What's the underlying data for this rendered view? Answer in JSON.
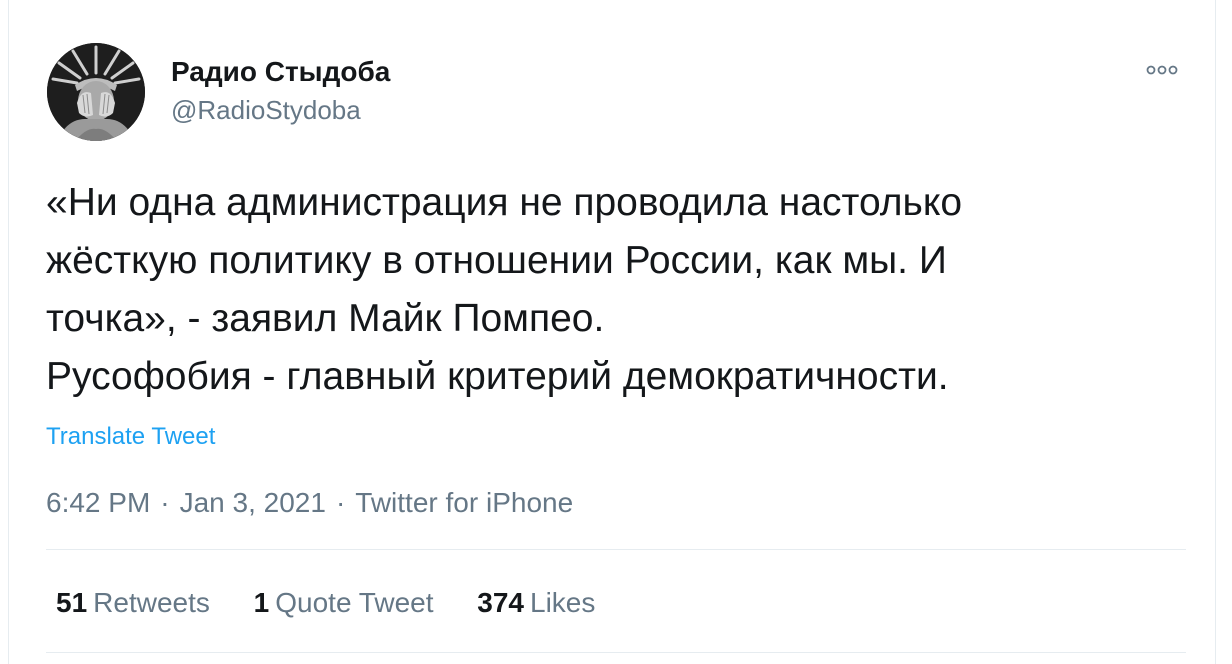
{
  "tweet": {
    "author": {
      "name": "Радио Стыдоба",
      "handle": "@RadioStydoba",
      "avatar": "statue-of-liberty-facepalm-avatar"
    },
    "more_icon": "more-dots-icon",
    "text_lines": [
      "«Ни одна администрация не проводила настолько",
      "жёсткую политику в отношении России, как мы. И",
      "точка», - заявил Майк Помпео.",
      "Русофобия - главный критерий демократичности."
    ],
    "translate_label": "Translate Tweet",
    "time": "6:42 PM",
    "date": "Jan 3, 2021",
    "source": "Twitter for iPhone",
    "separator": "·",
    "stats": {
      "retweets_count": "51",
      "retweets_label": "Retweets",
      "quotes_count": "1",
      "quotes_label": "Quote Tweet",
      "likes_count": "374",
      "likes_label": "Likes"
    }
  },
  "colors": {
    "text": "#14171a",
    "secondary": "#657786",
    "link": "#1da1f2",
    "divider": "#e6ecf0"
  }
}
